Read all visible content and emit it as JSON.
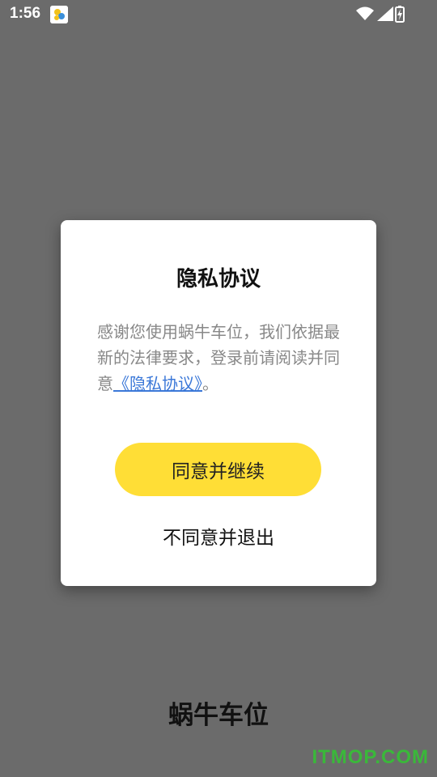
{
  "status_bar": {
    "time": "1:56",
    "notification_icon": "app-notification-icon",
    "wifi_icon": "wifi-icon",
    "signal_icon": "cellular-signal-icon",
    "battery_icon": "battery-charging-icon"
  },
  "dialog": {
    "title": "隐私协议",
    "body_prefix": "感谢您使用蜗牛车位，我们依据最新的法律要求，登录前请阅读并同意",
    "body_link": "《隐私协议》",
    "body_suffix": "。",
    "agree_label": "同意并继续",
    "disagree_label": "不同意并退出"
  },
  "app": {
    "name": "蜗牛车位"
  },
  "watermark": "ITMOP.COM",
  "colors": {
    "accent": "#ffde36",
    "link": "#3b78d8",
    "overlay": "#6b6b6b"
  }
}
